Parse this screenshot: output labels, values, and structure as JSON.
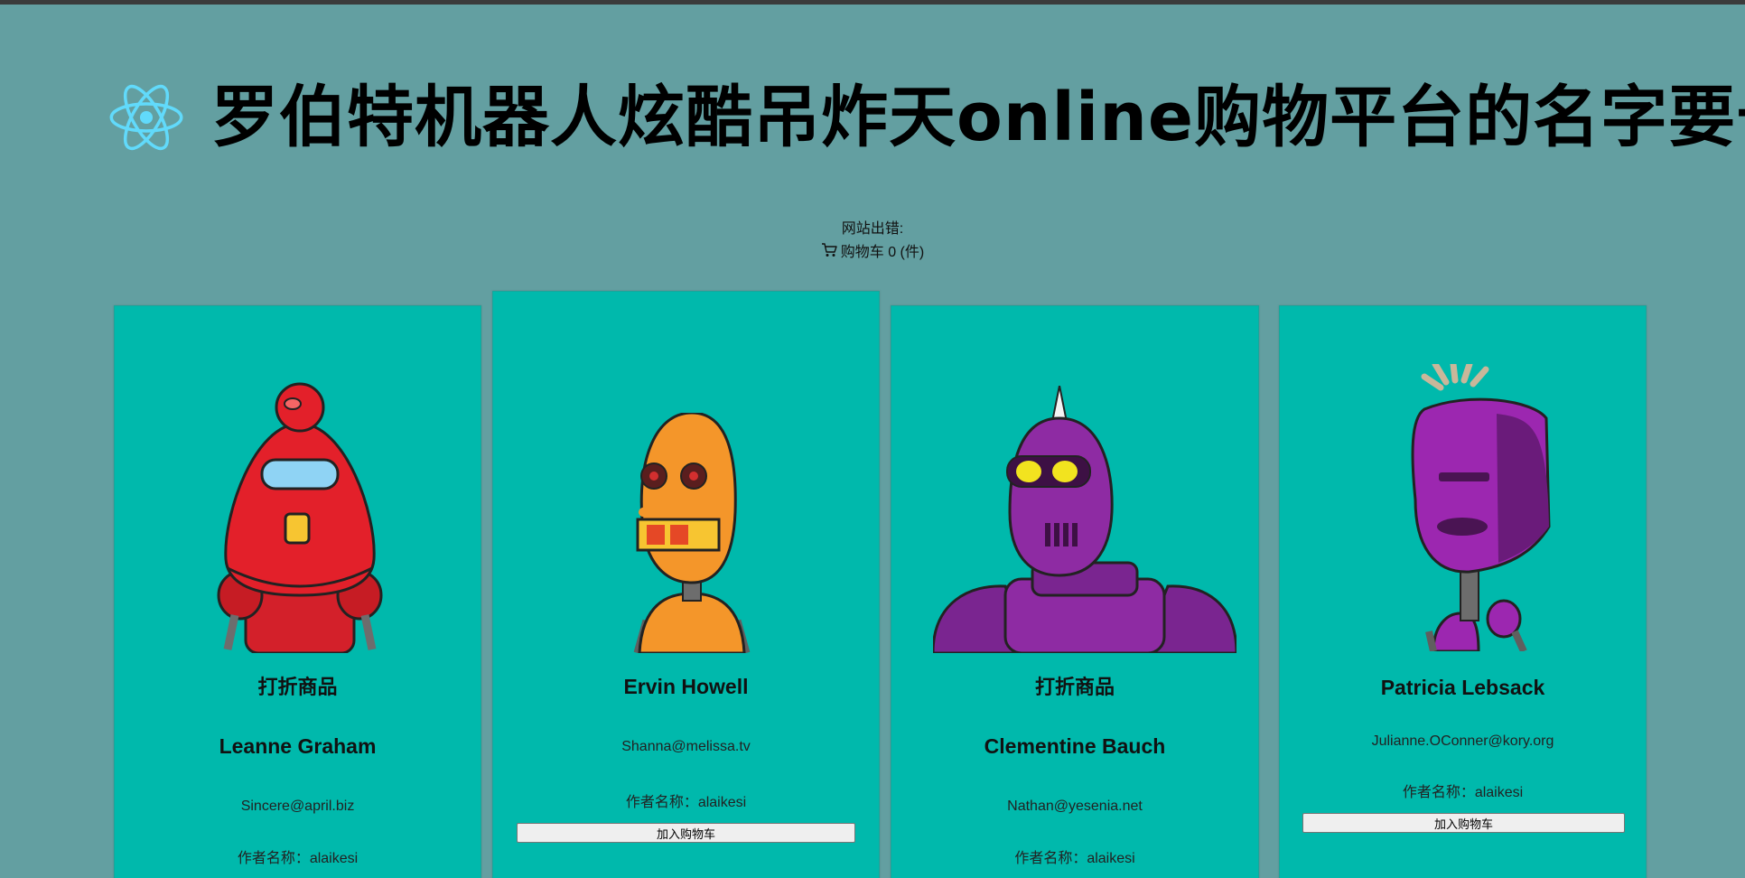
{
  "header": {
    "title": "罗伯特机器人炫酷吊炸天online购物平台的名字要长",
    "logo_icon": "react-atom-icon",
    "logo_color": "#61dafb"
  },
  "status": {
    "error_label": "网站出错:",
    "cart_label": "购物车 0 (件)",
    "cart_icon": "shopping-cart-icon"
  },
  "cards": [
    {
      "badge": "打折商品",
      "name": "Leanne Graham",
      "email": "Sincere@april.biz",
      "author": "作者名称：alaikesi"
    },
    {
      "name": "Ervin Howell",
      "email": "Shanna@melissa.tv",
      "author": "作者名称：alaikesi",
      "button": "加入购物车"
    },
    {
      "badge": "打折商品",
      "name": "Clementine Bauch",
      "email": "Nathan@yesenia.net",
      "author": "作者名称：alaikesi"
    },
    {
      "name": "Patricia Lebsack",
      "email": "Julianne.OConner@kory.org",
      "author": "作者名称：alaikesi",
      "button": "加入购物车"
    }
  ],
  "colors": {
    "background": "#639fa1",
    "card": "#00b9ac"
  }
}
